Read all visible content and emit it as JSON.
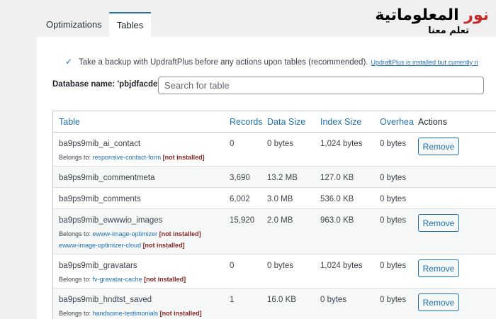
{
  "tabs": [
    {
      "label": "Optimizations",
      "active": false
    },
    {
      "label": "Tables",
      "active": true
    }
  ],
  "logo": {
    "main_red": "نور",
    "main_black": " المعلوماتية",
    "sub": "تعلم معنا"
  },
  "backup": {
    "checked": true,
    "label": "Take a backup with UpdraftPlus before any actions upon tables (recommended).",
    "link": "UpdraftPlus is installed but currently n"
  },
  "database": {
    "label": "Database name: 'pbjdfacdev'",
    "search_placeholder": "Search for table"
  },
  "table": {
    "headers": [
      "Table",
      "Records",
      "Data Size",
      "Index Size",
      "Overhea",
      "Actions"
    ],
    "belongs_label": "Belongs to:",
    "not_installed": "[not installed]",
    "remove_label": "Remove",
    "rows": [
      {
        "name": "ba9ps9mib_ai_contact",
        "records": "0",
        "data_size": "0 bytes",
        "index_size": "1,024 bytes",
        "overhead": "0 bytes",
        "plugins": [
          "responsive-contact-form"
        ],
        "removable": true
      },
      {
        "name": "ba9ps9mib_commentmeta",
        "records": "3,690",
        "data_size": "13.2 MB",
        "index_size": "127.0 KB",
        "overhead": "0 bytes",
        "plugins": [],
        "removable": false
      },
      {
        "name": "ba9ps9mib_comments",
        "records": "6,002",
        "data_size": "3.0 MB",
        "index_size": "536.0 KB",
        "overhead": "0 bytes",
        "plugins": [],
        "removable": false
      },
      {
        "name": "ba9ps9mib_ewwwio_images",
        "records": "15,920",
        "data_size": "2.0 MB",
        "index_size": "963.0 KB",
        "overhead": "0 bytes",
        "plugins": [
          "ewww-image-optimizer",
          "ewww-image-optimizer-cloud"
        ],
        "removable": true
      },
      {
        "name": "ba9ps9mib_gravatars",
        "records": "0",
        "data_size": "0 bytes",
        "index_size": "1,024 bytes",
        "overhead": "0 bytes",
        "plugins": [
          "fv-gravatar-cache"
        ],
        "removable": true
      },
      {
        "name": "ba9ps9mib_hndtst_saved",
        "records": "1",
        "data_size": "16.0 KB",
        "index_size": "0 bytes",
        "overhead": "0 bytes",
        "plugins": [
          "handsome-testimonials"
        ],
        "removable": true
      }
    ]
  }
}
